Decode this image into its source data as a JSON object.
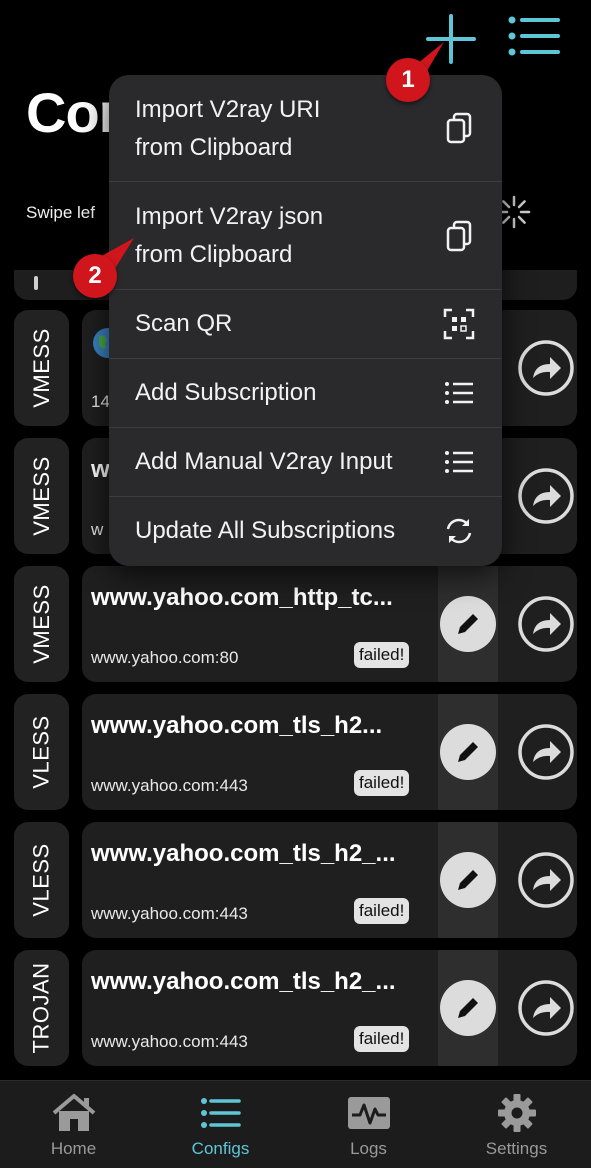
{
  "header": {
    "title": "Con",
    "swipe_hint": "Swipe lef"
  },
  "menu": {
    "items": [
      {
        "label_line1": "Import V2ray URI",
        "label_line2": "from Clipboard",
        "icon": "clipboard-icon"
      },
      {
        "label_line1": "Import V2ray json",
        "label_line2": "from Clipboard",
        "icon": "clipboard-icon"
      },
      {
        "label_line1": "Scan QR",
        "label_line2": "",
        "icon": "qr-scan-icon"
      },
      {
        "label_line1": "Add Subscription",
        "label_line2": "",
        "icon": "list-icon"
      },
      {
        "label_line1": "Add Manual V2ray Input",
        "label_line2": "",
        "icon": "list-icon"
      },
      {
        "label_line1": "Update All Subscriptions",
        "label_line2": "",
        "icon": "sync-icon"
      }
    ]
  },
  "configs": [
    {
      "protocol": "VMESS",
      "name": "",
      "host": "14",
      "status": ""
    },
    {
      "protocol": "VMESS",
      "name": "w",
      "host": "w",
      "status": ""
    },
    {
      "protocol": "VMESS",
      "name": "www.yahoo.com_http_tc...",
      "host": "www.yahoo.com:80",
      "status": "failed!"
    },
    {
      "protocol": "VLESS",
      "name": "www.yahoo.com_tls_h2...",
      "host": "www.yahoo.com:443",
      "status": "failed!"
    },
    {
      "protocol": "VLESS",
      "name": "www.yahoo.com_tls_h2_...",
      "host": "www.yahoo.com:443",
      "status": "failed!"
    },
    {
      "protocol": "TROJAN",
      "name": "www.yahoo.com_tls_h2_...",
      "host": "www.yahoo.com:443",
      "status": "failed!"
    }
  ],
  "callouts": {
    "one": "1",
    "two": "2"
  },
  "tabs": [
    {
      "label": "Home",
      "icon": "home-icon"
    },
    {
      "label": "Configs",
      "icon": "list-icon"
    },
    {
      "label": "Logs",
      "icon": "pulse-icon"
    },
    {
      "label": "Settings",
      "icon": "gear-icon"
    }
  ],
  "colors": {
    "accent": "#5fc6d8",
    "callout": "#d0161c",
    "background": "#000000"
  }
}
